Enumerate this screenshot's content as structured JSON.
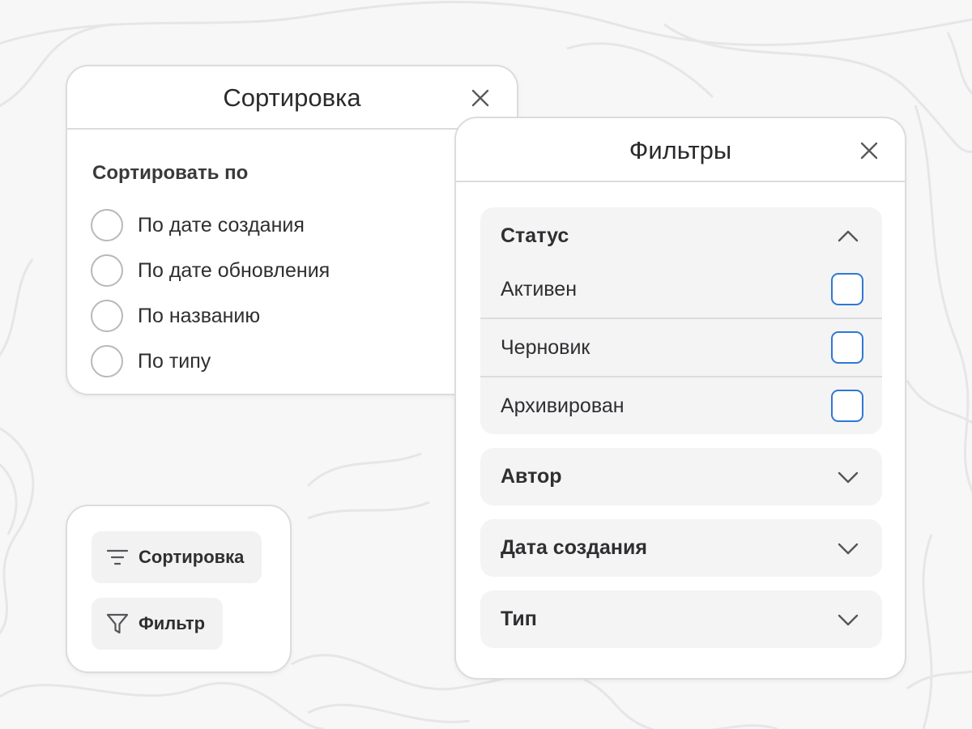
{
  "sort_panel": {
    "title": "Сортировка",
    "section_label": "Сортировать по",
    "options": [
      {
        "label": "По дате создания",
        "selected": false
      },
      {
        "label": "По дате обновления",
        "selected": false
      },
      {
        "label": "По названию",
        "selected": false
      },
      {
        "label": "По типу",
        "selected": false
      }
    ],
    "close_icon": "close-icon"
  },
  "filter_panel": {
    "title": "Фильтры",
    "close_icon": "close-icon",
    "groups": [
      {
        "title": "Статус",
        "expanded": true,
        "icon": "chevron-up-icon",
        "items": [
          {
            "label": "Активен",
            "checked": false
          },
          {
            "label": "Черновик",
            "checked": false
          },
          {
            "label": "Архивирован",
            "checked": false
          }
        ]
      },
      {
        "title": "Автор",
        "expanded": false,
        "icon": "chevron-down-icon"
      },
      {
        "title": "Дата создания",
        "expanded": false,
        "icon": "chevron-down-icon"
      },
      {
        "title": "Тип",
        "expanded": false,
        "icon": "chevron-down-icon"
      }
    ]
  },
  "toolbar": {
    "sort_label": "Сортировка",
    "sort_icon": "sort-lines-icon",
    "filter_label": "Фильтр",
    "filter_icon": "funnel-icon"
  },
  "colors": {
    "checkbox_accent": "#2f78d4",
    "border": "#dcdcdf",
    "group_bg": "#f4f4f5",
    "text": "#2b2b2e"
  }
}
